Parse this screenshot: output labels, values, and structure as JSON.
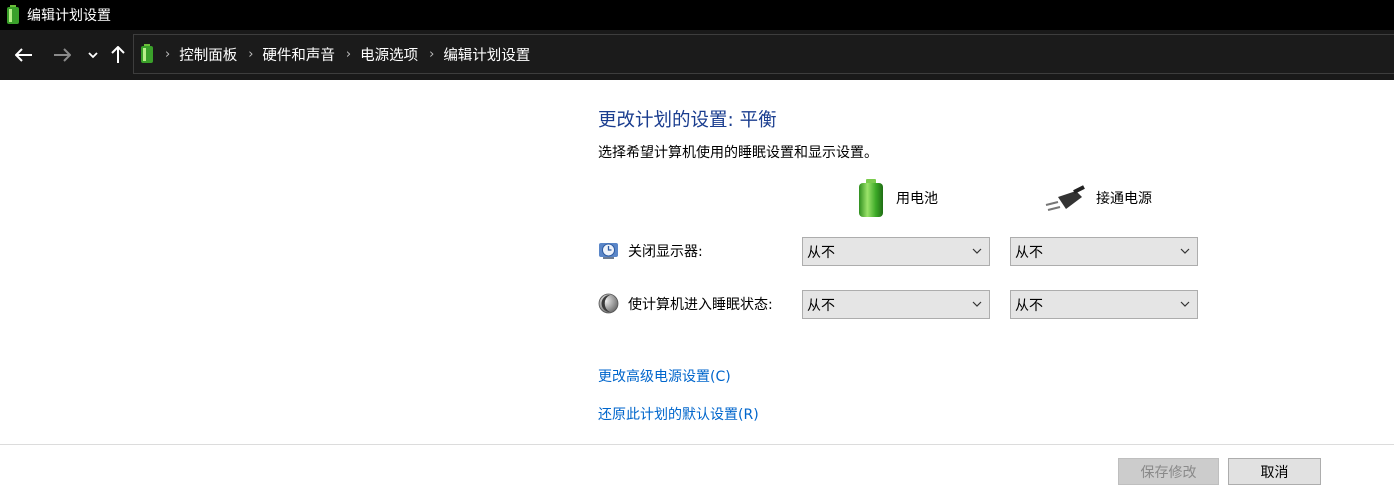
{
  "window": {
    "title": "编辑计划设置"
  },
  "breadcrumb": {
    "items": [
      {
        "label": "控制面板"
      },
      {
        "label": "硬件和声音"
      },
      {
        "label": "电源选项"
      },
      {
        "label": "编辑计划设置"
      }
    ],
    "separator": "›"
  },
  "main": {
    "heading": "更改计划的设置: 平衡",
    "subtitle": "选择希望计算机使用的睡眠设置和显示设置。",
    "columns": {
      "battery": {
        "label": "用电池",
        "icon": "battery-icon"
      },
      "plugged": {
        "label": "接通电源",
        "icon": "power-plug-icon"
      }
    },
    "settings": [
      {
        "label": "关闭显示器:",
        "icon": "display-clock-icon",
        "battery_value": "从不",
        "plugged_value": "从不"
      },
      {
        "label": "使计算机进入睡眠状态:",
        "icon": "moon-icon",
        "battery_value": "从不",
        "plugged_value": "从不"
      }
    ],
    "links": {
      "advanced": "更改高级电源设置(C)",
      "restore": "还原此计划的默认设置(R)"
    }
  },
  "footer": {
    "save_label": "保存修改",
    "save_enabled": false,
    "cancel_label": "取消"
  },
  "colors": {
    "heading": "#1a3d8f",
    "link": "#0066cc",
    "titlebar": "#000000",
    "navbar": "#191919"
  }
}
